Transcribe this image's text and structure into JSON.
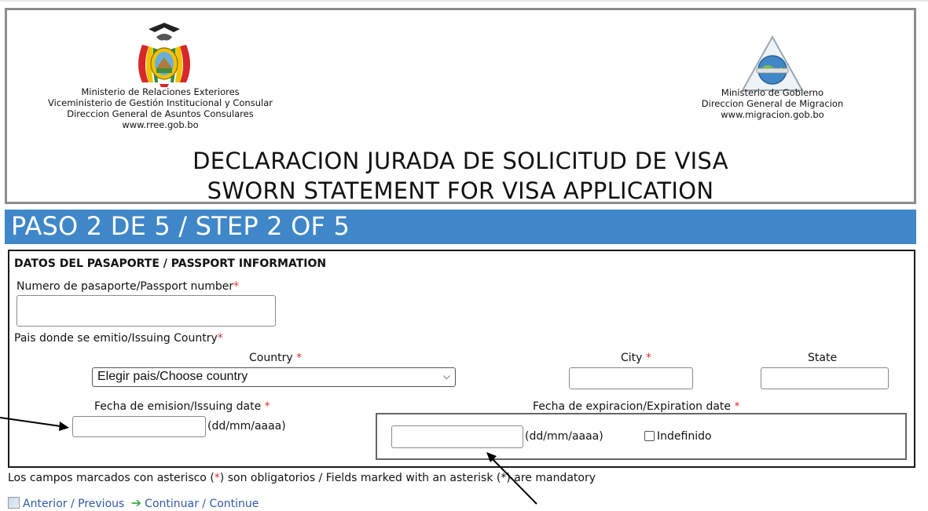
{
  "header": {
    "left_ministry": [
      "Ministerio de Relaciones Exteriores",
      "Viceministerio de Gestión Institucional y Consular",
      "Direccion General de Asuntos Consulares",
      "www.rree.gob.bo"
    ],
    "right_ministry": [
      "Ministerio de Gobierno",
      "Direccion General de Migracion",
      "www.migracion.gob.bo"
    ],
    "title_es": "DECLARACION JURADA DE SOLICITUD DE VISA",
    "title_en": "SWORN STATEMENT FOR VISA APPLICATION"
  },
  "step": {
    "label": "PASO 2 DE 5 / STEP 2 OF 5",
    "color": "#3f87c8"
  },
  "form": {
    "section_title": "DATOS DEL PASAPORTE / PASSPORT INFORMATION",
    "passport_number_label": "Numero de pasaporte/Passport number",
    "passport_number_value": "",
    "issuing_country_label": "Pais donde se emitio/Issuing Country",
    "country_label": "Country",
    "country_selected": "Elegir pais/Choose country",
    "city_label": "City",
    "city_value": "",
    "state_label": "State",
    "state_value": "",
    "issuing_date_label": "Fecha de emision/Issuing date",
    "issuing_date_value": "",
    "issuing_date_format": "(dd/mm/aaaa)",
    "expiration_date_label": "Fecha de expiracion/Expiration date",
    "expiration_date_value": "",
    "expiration_date_format": "(dd/mm/aaaa)",
    "indefinite_label": "Indefinido",
    "indefinite_checked": false,
    "required_mark": "*"
  },
  "footer": {
    "note_before": "Los campos marcados con asterisco (",
    "note_star": "*",
    "note_after": ") son obligatorios / Fields marked with an asterisk (*) are mandatory",
    "previous_label": "Anterior / Previous",
    "continue_label": "Continuar / Continue"
  },
  "colors": {
    "required": "#e0302e",
    "link": "#2f5aa6",
    "step_bar": "#3f87c8"
  }
}
